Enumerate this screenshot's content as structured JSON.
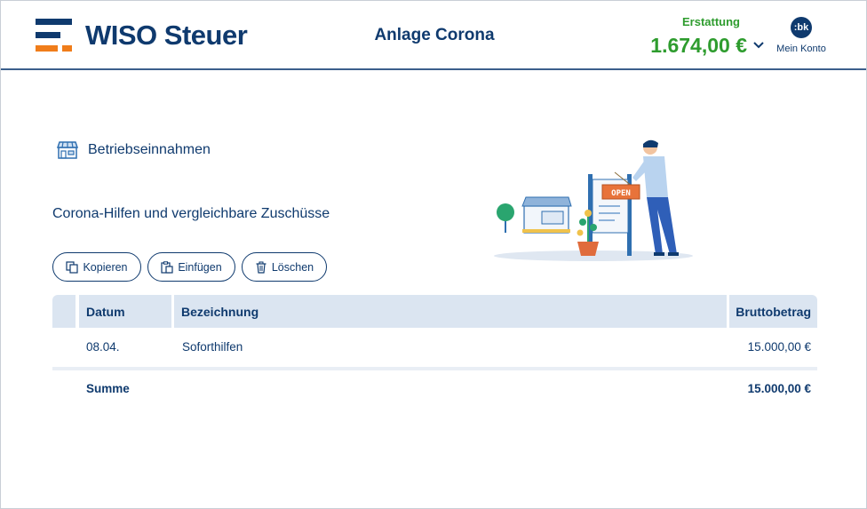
{
  "header": {
    "logo_text": "WISO Steuer",
    "title": "Anlage Corona",
    "refund_label": "Erstattung",
    "refund_amount": "1.674,00 €",
    "account_avatar": ":bk",
    "account_label": "Mein Konto"
  },
  "section": {
    "icon": "shop-icon",
    "title": "Betriebseinnahmen",
    "subtitle": "Corona-Hilfen und vergleichbare Zuschüsse"
  },
  "illustration": {
    "sign_text": "OPEN"
  },
  "toolbar": {
    "copy_label": "Kopieren",
    "paste_label": "Einfügen",
    "delete_label": "Löschen"
  },
  "table": {
    "headers": {
      "date": "Datum",
      "description": "Bezeichnung",
      "amount": "Bruttobetrag"
    },
    "rows": [
      {
        "date": "08.04.",
        "description": "Soforthilfen",
        "amount": "15.000,00 €"
      }
    ],
    "total_label": "Summe",
    "total_amount": "15.000,00 €"
  },
  "colors": {
    "brand_navy": "#0f3a6e",
    "brand_orange": "#f07d1a",
    "refund_green": "#2e9c2e",
    "table_header": "#dbe5f1"
  }
}
